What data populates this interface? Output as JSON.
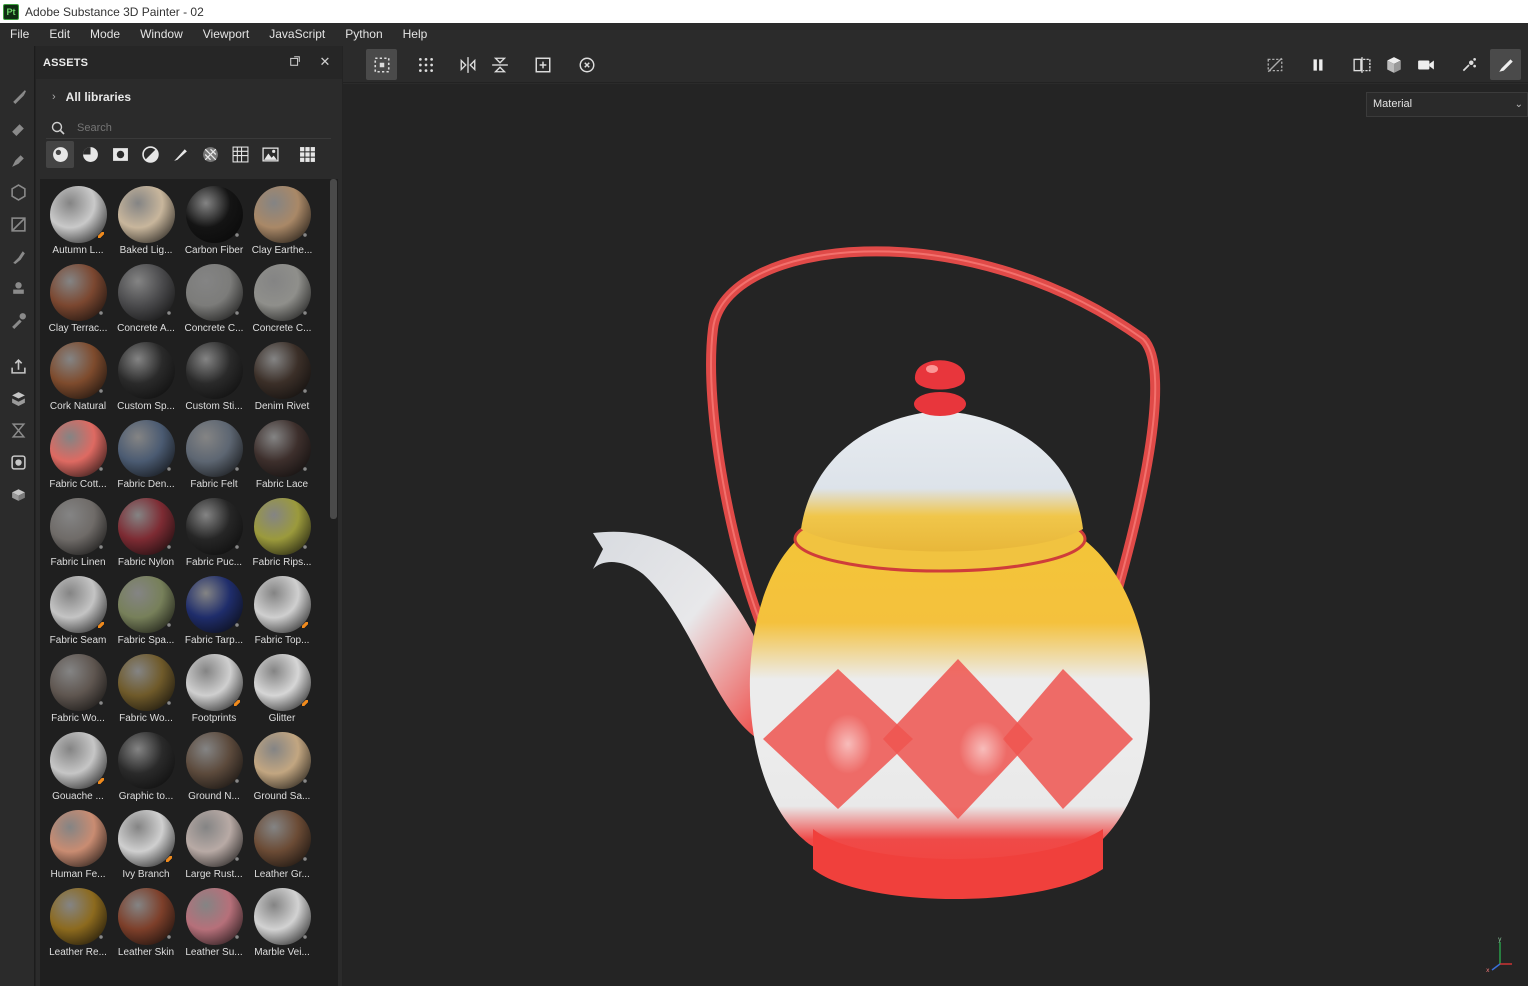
{
  "window": {
    "title": "Adobe Substance 3D Painter - 02",
    "app_icon": "Pt"
  },
  "menu": [
    "File",
    "Edit",
    "Mode",
    "Window",
    "Viewport",
    "JavaScript",
    "Python",
    "Help"
  ],
  "assets_panel": {
    "title": "ASSETS",
    "libraries_label": "All libraries",
    "search_placeholder": "Search",
    "items": [
      {
        "label": "Autumn L...",
        "color": "#c9c9c9",
        "badge": "brush"
      },
      {
        "label": "Baked Lig...",
        "color": "#c8b69c",
        "badge": ""
      },
      {
        "label": "Carbon Fiber",
        "color": "#141414",
        "badge": "dots"
      },
      {
        "label": "Clay Earthe...",
        "color": "#a98867",
        "badge": "dots"
      },
      {
        "label": "Clay Terrac...",
        "color": "#7b4730",
        "badge": "dots"
      },
      {
        "label": "Concrete A...",
        "color": "#4b4b4d",
        "badge": "dots"
      },
      {
        "label": "Concrete C...",
        "color": "#7c7c7a",
        "badge": "dots"
      },
      {
        "label": "Concrete C...",
        "color": "#8f8f8b",
        "badge": "dots"
      },
      {
        "label": "Cork Natural",
        "color": "#7e4b2d",
        "badge": "dots"
      },
      {
        "label": "Custom Sp...",
        "color": "#2a2a2a",
        "badge": ""
      },
      {
        "label": "Custom Sti...",
        "color": "#2a2a2a",
        "badge": ""
      },
      {
        "label": "Denim Rivet",
        "color": "#3b2f28",
        "badge": "dots"
      },
      {
        "label": "Fabric Cott...",
        "color": "#de6a62",
        "badge": "dots"
      },
      {
        "label": "Fabric Den...",
        "color": "#4b5b72",
        "badge": "dots"
      },
      {
        "label": "Fabric Felt",
        "color": "#5d6672",
        "badge": "dots"
      },
      {
        "label": "Fabric Lace",
        "color": "#3d2f2c",
        "badge": "dots"
      },
      {
        "label": "Fabric Linen",
        "color": "#6f6b68",
        "badge": "dots"
      },
      {
        "label": "Fabric Nylon",
        "color": "#7d2b33",
        "badge": "dots"
      },
      {
        "label": "Fabric Puc...",
        "color": "#262626",
        "badge": "dots"
      },
      {
        "label": "Fabric Rips...",
        "color": "#9b9a3c",
        "badge": "dots"
      },
      {
        "label": "Fabric Seam",
        "color": "#c4c4c4",
        "badge": "brush"
      },
      {
        "label": "Fabric Spa...",
        "color": "#77805a",
        "badge": "dots"
      },
      {
        "label": "Fabric Tarp...",
        "color": "#1f2d6b",
        "badge": "dots"
      },
      {
        "label": "Fabric Top...",
        "color": "#cfcfcf",
        "badge": "brush"
      },
      {
        "label": "Fabric Wo...",
        "color": "#5f5650",
        "badge": "dots"
      },
      {
        "label": "Fabric Wo...",
        "color": "#6f5a2a",
        "badge": "dots"
      },
      {
        "label": "Footprints",
        "color": "#cfcfcf",
        "badge": "brush"
      },
      {
        "label": "Glitter",
        "color": "#d6d6d6",
        "badge": "brush"
      },
      {
        "label": "Gouache ...",
        "color": "#c6c6c6",
        "badge": "brush"
      },
      {
        "label": "Graphic to...",
        "color": "#2a2a2a",
        "badge": ""
      },
      {
        "label": "Ground N...",
        "color": "#5c4a3c",
        "badge": "dots"
      },
      {
        "label": "Ground Sa...",
        "color": "#c2a681",
        "badge": "dots"
      },
      {
        "label": "Human Fe...",
        "color": "#c98c72",
        "badge": ""
      },
      {
        "label": "Ivy Branch",
        "color": "#cfcfcf",
        "badge": "brush"
      },
      {
        "label": "Large Rust...",
        "color": "#b8aaa5",
        "badge": "dots"
      },
      {
        "label": "Leather Gr...",
        "color": "#6b4b35",
        "badge": "dots"
      },
      {
        "label": "Leather Re...",
        "color": "#8c6a1e",
        "badge": "dots"
      },
      {
        "label": "Leather Skin",
        "color": "#7d3f2a",
        "badge": "dots"
      },
      {
        "label": "Leather Su...",
        "color": "#b6707a",
        "badge": "dots"
      },
      {
        "label": "Marble Vei...",
        "color": "#d2d2d2",
        "badge": "dots"
      }
    ]
  },
  "viewport": {
    "mode_select": "Material"
  }
}
